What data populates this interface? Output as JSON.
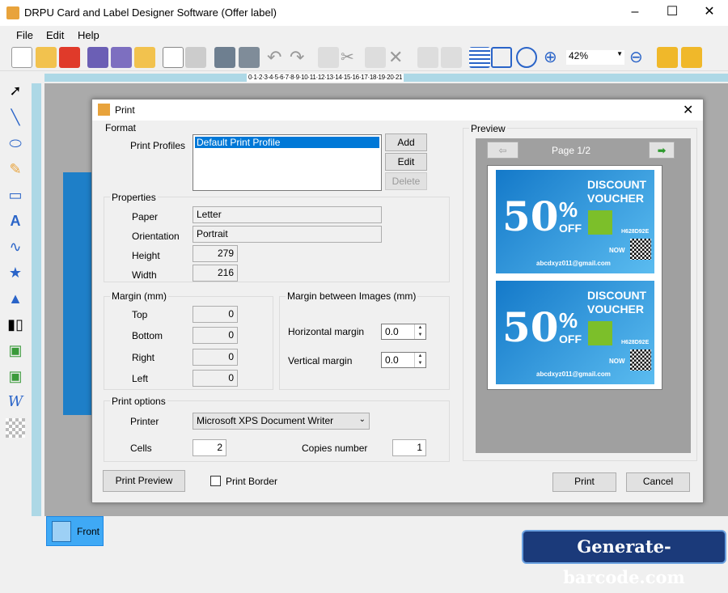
{
  "window": {
    "title": "DRPU Card and Label Designer Software (Offer label)",
    "minimize": "–",
    "maximize": "☐",
    "close": "✕"
  },
  "menu": [
    "File",
    "Edit",
    "Help"
  ],
  "toolbar": {
    "zoom_value": "42%",
    "icons": [
      "new-icon",
      "open-icon",
      "close-file-icon",
      "save-icon",
      "save-as-icon",
      "export-icon",
      "edit-icon",
      "print-icon",
      "database-add-icon",
      "database-icon",
      "undo-icon",
      "redo-icon",
      "copy-icon",
      "cut-icon",
      "paste-icon",
      "delete-icon",
      "bring-front-icon",
      "send-back-icon",
      "grid-icon",
      "fit-icon",
      "center-icon",
      "zoom-in-icon",
      "zoom-out-icon",
      "lock-icon",
      "unlock-icon"
    ]
  },
  "ruler": {
    "numbers": "0·1·2·3·4·5·6·7·8·9·10·11·12·13·14·15·16·17·18·19·20·21"
  },
  "tools": [
    "select-icon",
    "line-icon",
    "ellipse-icon",
    "pencil-icon",
    "rectangle-icon",
    "text-icon",
    "curve-icon",
    "star-icon",
    "triangle-icon",
    "barcode-icon",
    "image-icon",
    "picture-library-icon",
    "word-art-icon",
    "pattern-icon"
  ],
  "dialog": {
    "title": "Print",
    "close": "✕",
    "format": {
      "legend": "Format",
      "profiles_label": "Print Profiles",
      "profiles": [
        "Default Print Profile"
      ],
      "add": "Add",
      "edit": "Edit",
      "delete": "Delete"
    },
    "properties": {
      "legend": "Properties",
      "paper_label": "Paper",
      "paper": "Letter",
      "orientation_label": "Orientation",
      "orientation": "Portrait",
      "height_label": "Height",
      "height": "279",
      "width_label": "Width",
      "width": "216"
    },
    "margin": {
      "legend": "Margin (mm)",
      "top_label": "Top",
      "top": "0",
      "bottom_label": "Bottom",
      "bottom": "0",
      "right_label": "Right",
      "right": "0",
      "left_label": "Left",
      "left": "0"
    },
    "margin_images": {
      "legend": "Margin between Images (mm)",
      "horizontal_label": "Horizontal margin",
      "horizontal": "0.0",
      "vertical_label": "Vertical margin",
      "vertical": "0.0"
    },
    "print_options": {
      "legend": "Print options",
      "printer_label": "Printer",
      "printer": "Microsoft XPS Document Writer",
      "cells_label": "Cells",
      "cells": "2",
      "copies_label": "Copies number",
      "copies": "1"
    },
    "preview": {
      "legend": "Preview",
      "page": "Page 1/2",
      "voucher": {
        "title1": "DISCOUNT",
        "title2": "VOUCHER",
        "big": "50",
        "pct": "%",
        "off": "OFF",
        "code": "H628D92E",
        "now": "NOW",
        "email": "abcdxyz011@gmail.com"
      }
    },
    "print_preview": "Print Preview",
    "print_border": "Print Border",
    "print": "Print",
    "cancel": "Cancel"
  },
  "tabs": {
    "front": "Front"
  },
  "watermark": "Generate-barcode.com",
  "colors": {
    "accent": "#0078d7",
    "ruler": "#add8e6",
    "voucher": "#1479c9",
    "watermark_bg": "#1b3a7a"
  }
}
